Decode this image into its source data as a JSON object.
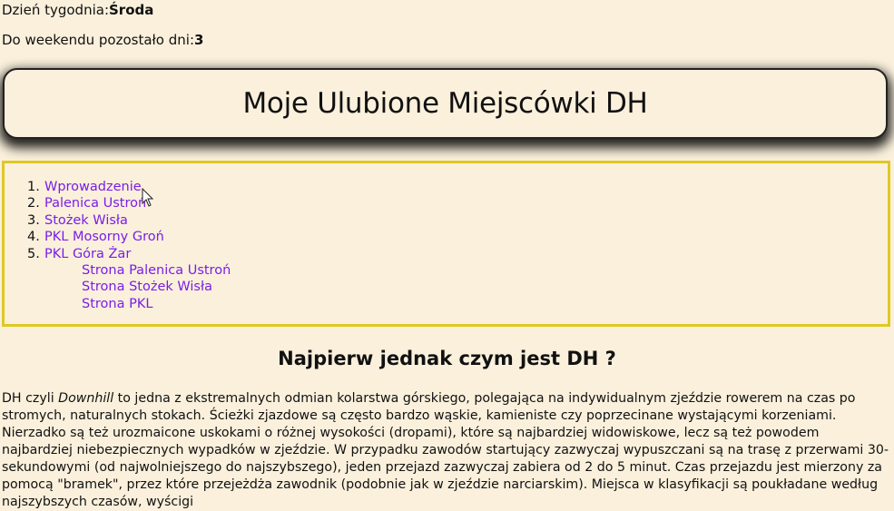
{
  "info": {
    "day_label": "Dzień tygodnia:",
    "day_value": "Środa",
    "weekend_label": "Do weekendu pozostało dni:",
    "weekend_value": "3"
  },
  "header": {
    "title": "Moje Ulubione Miejscówki DH"
  },
  "nav": {
    "items": [
      {
        "num": "1.",
        "label": "Wprowadzenie"
      },
      {
        "num": "2.",
        "label": "Palenica Ustroń"
      },
      {
        "num": "3.",
        "label": "Stożek Wisła"
      },
      {
        "num": "4.",
        "label": "PKL Mosorny Groń"
      },
      {
        "num": "5.",
        "label": "PKL Góra Żar"
      }
    ],
    "sub_links": [
      {
        "label": "Strona Palenica Ustroń"
      },
      {
        "label": "Strona Stożek Wisła"
      },
      {
        "label": "Strona PKL"
      }
    ]
  },
  "section": {
    "title": "Najpierw jednak czym jest DH ?",
    "p_start": "DH czyli ",
    "p_italic": "Downhill",
    "p_rest": " to jedna z ekstremalnych odmian kolarstwa górskiego, polegająca na indywidualnym zjeździe rowerem na czas po stromych, naturalnych stokach. Ścieżki zjazdowe są często bardzo wąskie, kamieniste czy poprzecinane wystającymi korzeniami. Nierzadko są też urozmaicone uskokami o różnej wysokości (dropami), które są najbardziej widowiskowe, lecz są też powodem najbardziej niebezpiecznych wypadków w zjeździe. W przypadku zawodów startujący zazwyczaj wypuszczani są na trasę z przerwami 30-sekundowymi (od najwolniejszego do najszybszego), jeden przejazd zazwyczaj zabiera od 2 do 5 minut. Czas przejazdu jest mierzony za pomocą \"bramek\", przez które przejeżdża zawodnik (podobnie jak w zjeździe narciarskim). Miejsca w klasyfikacji są poukładane według najszybszych czasów, wyścigi"
  },
  "colors": {
    "background": "#faf0dc",
    "link": "#7a1ee6",
    "nav_border": "#e0c824"
  }
}
